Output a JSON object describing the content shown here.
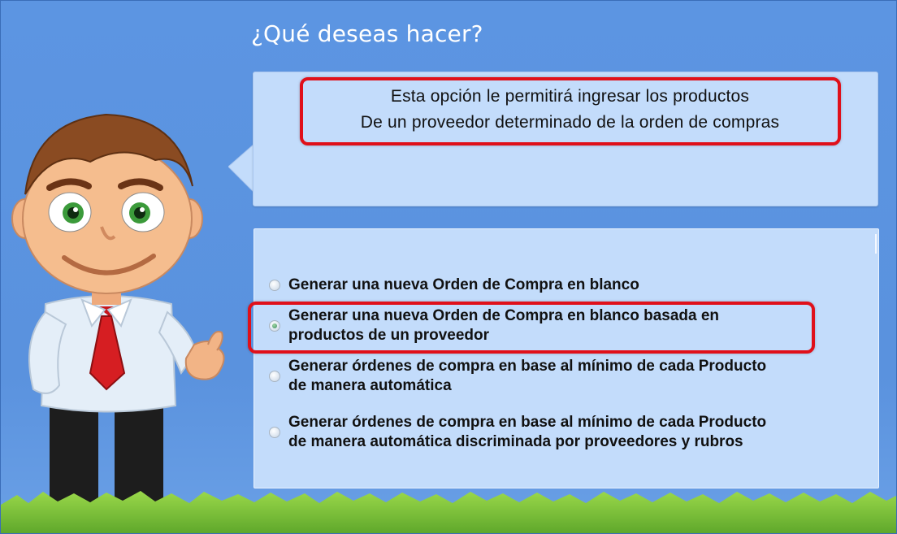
{
  "window": {
    "title": "¿Qué deseas hacer?"
  },
  "description": {
    "line1": "Esta opción le permitirá ingresar los productos",
    "line2": "De un proveedor determinado de la orden de compras"
  },
  "options": [
    {
      "label": "Generar una nueva Orden de Compra en blanco",
      "selected": false
    },
    {
      "label_line1": "Generar una nueva Orden de Compra en blanco basada en",
      "label_line2": "productos de un proveedor",
      "selected": true
    },
    {
      "label_line1": "Generar órdenes de compra en base al mínimo de cada Producto",
      "label_line2": "de manera automática",
      "selected": false
    },
    {
      "label_line1": "Generar órdenes de compra en base al mínimo de cada Producto",
      "label_line2": "de manera automática discriminada por proveedores y rubros",
      "selected": false
    }
  ],
  "colors": {
    "background": "#5a93e0",
    "panel": "#c3dcfb",
    "highlight": "#e0101a",
    "grass": "#7cc43c"
  }
}
